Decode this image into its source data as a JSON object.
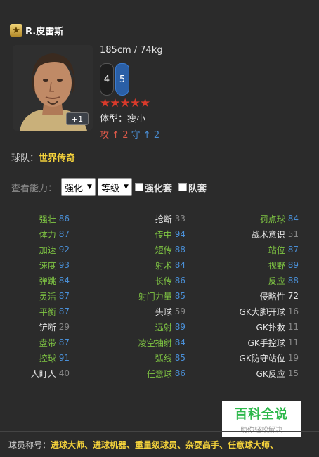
{
  "player": {
    "name": "R.皮雷斯",
    "height_weight": "185cm / 74kg",
    "left_foot": "4",
    "right_foot": "5",
    "stars": "★★★★★",
    "body_label": "体型：",
    "body_value": "瘦小",
    "atk_label": "攻",
    "atk_value": "2",
    "def_label": "守",
    "def_value": "2",
    "plus_badge": "+1"
  },
  "team": {
    "label": "球队：",
    "value": "世界传奇"
  },
  "view": {
    "label": "查看能力：",
    "select1": "强化",
    "select2": "等级",
    "check1": "强化套",
    "check2": "队套"
  },
  "stats_rows": [
    [
      {
        "n": "强壮",
        "v": "86",
        "nc": "green",
        "vc": "blue"
      },
      {
        "n": "抢断",
        "v": "33",
        "nc": "white",
        "vc": "grey"
      },
      {
        "n": "罚点球",
        "v": "84",
        "nc": "green",
        "vc": "blue"
      }
    ],
    [
      {
        "n": "体力",
        "v": "87",
        "nc": "green",
        "vc": "blue"
      },
      {
        "n": "传中",
        "v": "94",
        "nc": "green",
        "vc": "blue"
      },
      {
        "n": "战术意识",
        "v": "51",
        "nc": "white",
        "vc": "grey"
      }
    ],
    [
      {
        "n": "加速",
        "v": "92",
        "nc": "green",
        "vc": "blue"
      },
      {
        "n": "短传",
        "v": "88",
        "nc": "green",
        "vc": "blue"
      },
      {
        "n": "站位",
        "v": "87",
        "nc": "green",
        "vc": "blue"
      }
    ],
    [
      {
        "n": "速度",
        "v": "93",
        "nc": "green",
        "vc": "blue"
      },
      {
        "n": "射术",
        "v": "84",
        "nc": "green",
        "vc": "blue"
      },
      {
        "n": "视野",
        "v": "89",
        "nc": "green",
        "vc": "blue"
      }
    ],
    [
      {
        "n": "弹跳",
        "v": "84",
        "nc": "green",
        "vc": "blue"
      },
      {
        "n": "长传",
        "v": "86",
        "nc": "green",
        "vc": "blue"
      },
      {
        "n": "反应",
        "v": "88",
        "nc": "green",
        "vc": "blue"
      }
    ],
    [
      {
        "n": "灵活",
        "v": "87",
        "nc": "green",
        "vc": "blue"
      },
      {
        "n": "射门力量",
        "v": "85",
        "nc": "green",
        "vc": "blue"
      },
      {
        "n": "侵略性",
        "v": "72",
        "nc": "white",
        "vc": "white"
      }
    ],
    [
      {
        "n": "平衡",
        "v": "87",
        "nc": "green",
        "vc": "blue"
      },
      {
        "n": "头球",
        "v": "59",
        "nc": "white",
        "vc": "grey"
      },
      {
        "n": "GK大脚开球",
        "v": "16",
        "nc": "white",
        "vc": "grey"
      }
    ],
    [
      {
        "n": "铲断",
        "v": "29",
        "nc": "white",
        "vc": "grey"
      },
      {
        "n": "远射",
        "v": "89",
        "nc": "green",
        "vc": "blue"
      },
      {
        "n": "GK扑救",
        "v": "11",
        "nc": "white",
        "vc": "grey"
      }
    ],
    [
      {
        "n": "盘带",
        "v": "87",
        "nc": "green",
        "vc": "blue"
      },
      {
        "n": "凌空抽射",
        "v": "84",
        "nc": "green",
        "vc": "blue"
      },
      {
        "n": "GK手控球",
        "v": "11",
        "nc": "white",
        "vc": "grey"
      }
    ],
    [
      {
        "n": "控球",
        "v": "91",
        "nc": "green",
        "vc": "blue"
      },
      {
        "n": "弧线",
        "v": "85",
        "nc": "green",
        "vc": "blue"
      },
      {
        "n": "GK防守站位",
        "v": "19",
        "nc": "white",
        "vc": "grey"
      }
    ],
    [
      {
        "n": "人盯人",
        "v": "40",
        "nc": "white",
        "vc": "grey"
      },
      {
        "n": "任意球",
        "v": "86",
        "nc": "green",
        "vc": "blue"
      },
      {
        "n": "GK反应",
        "v": "15",
        "nc": "white",
        "vc": "grey"
      }
    ]
  ],
  "watermark": {
    "big": "百科全说",
    "small": "助你轻松解决"
  },
  "titles": {
    "label": "球员称号：",
    "value": "进球大师、进球机器、重量级球员、杂耍高手、任意球大师、"
  },
  "colors": {
    "background": "#2b2b2b",
    "green": "#7fc543",
    "blue": "#4a8fd6",
    "gold": "#f2d03b",
    "red": "#d83a2b"
  }
}
